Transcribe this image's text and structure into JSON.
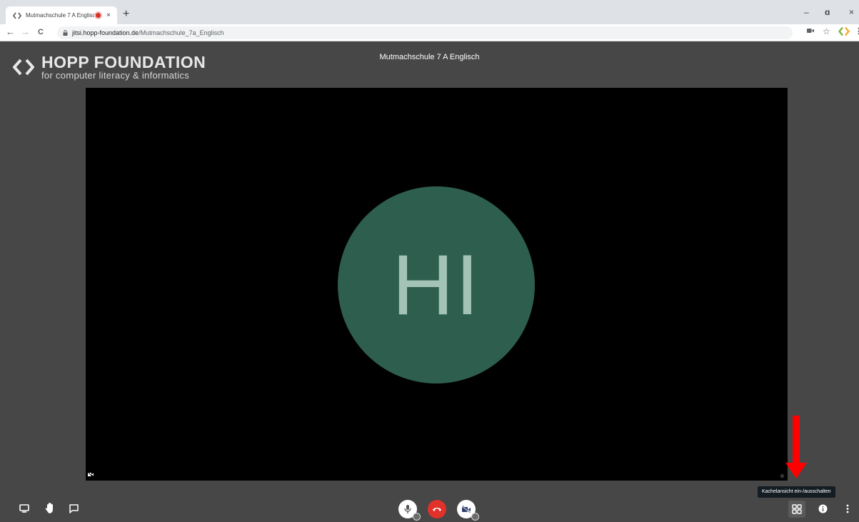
{
  "browser": {
    "tab_title": "Mutmachschule 7 A Englisch",
    "tab_close": "×",
    "new_tab": "+",
    "url_host": "jitsi.hopp-foundation.de",
    "url_path": "/Mutmachschule_7a_Englisch",
    "nav_back": "←",
    "nav_forward": "→",
    "nav_reload": "C",
    "win_minimize": "–",
    "win_restore": "ɑ",
    "win_close": "×",
    "bookmark": "☆"
  },
  "brand": {
    "name": "HOPP FOUNDATION",
    "tagline": "for computer literacy & informatics"
  },
  "meeting": {
    "title": "Mutmachschule 7 A Englisch"
  },
  "participant": {
    "initials": "HI",
    "avatar_color": "#2d5e4e",
    "initials_color": "#a4c3b7"
  },
  "tooltip": {
    "tile_view": "Kachelansicht ein-/ausschalten"
  },
  "colors": {
    "stage_bg": "#474747",
    "hangup": "#e1312b",
    "arrow": "#ff0000"
  },
  "toolbar": {
    "left": [
      "screen-share-icon",
      "raise-hand-icon",
      "chat-icon"
    ],
    "center": [
      "microphone-icon",
      "hangup-icon",
      "camera-off-icon"
    ],
    "right": [
      "tile-view-icon",
      "info-icon",
      "more-icon"
    ]
  }
}
